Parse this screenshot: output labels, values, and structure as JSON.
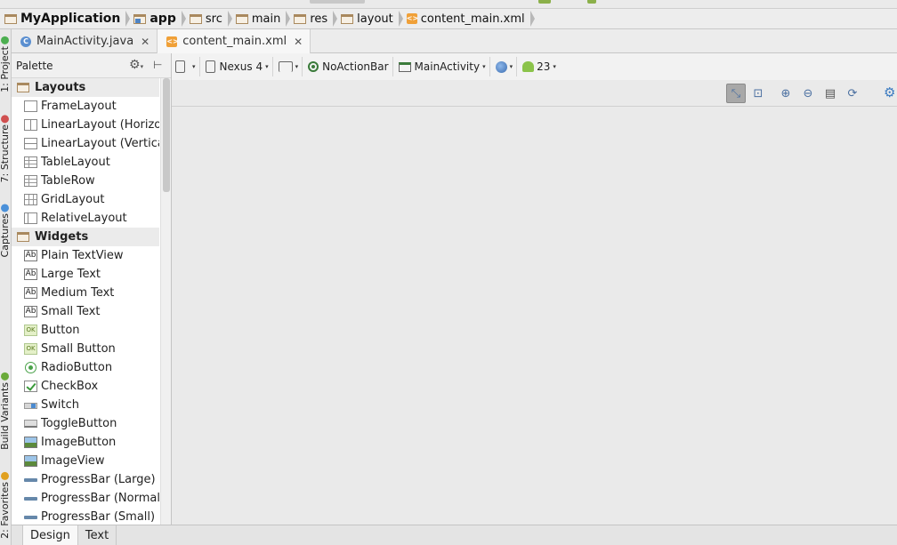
{
  "breadcrumb": [
    {
      "label": "MyApplication",
      "icon": "project-folder-icon",
      "bold": true
    },
    {
      "label": "app",
      "icon": "module-folder-icon",
      "bold": true
    },
    {
      "label": "src",
      "icon": "folder-icon",
      "bold": false
    },
    {
      "label": "main",
      "icon": "folder-icon",
      "bold": false
    },
    {
      "label": "res",
      "icon": "res-folder-icon",
      "bold": false
    },
    {
      "label": "layout",
      "icon": "folder-icon",
      "bold": false
    },
    {
      "label": "content_main.xml",
      "icon": "xml-file-icon",
      "bold": false
    }
  ],
  "side_tools": [
    {
      "label": "1: Project",
      "icon": "project-icon"
    },
    {
      "label": "7: Structure",
      "icon": "structure-icon"
    },
    {
      "label": "Captures",
      "icon": "captures-icon"
    },
    {
      "label": "Build Variants",
      "icon": "build-variants-icon"
    },
    {
      "label": "2: Favorites",
      "icon": "star-icon"
    }
  ],
  "tabs": [
    {
      "label": "MainActivity.java",
      "active": false
    },
    {
      "label": "content_main.xml",
      "active": true
    }
  ],
  "palette": {
    "title": "Palette",
    "groups": [
      {
        "name": "Layouts",
        "items": [
          {
            "label": "FrameLayout",
            "icon": "box"
          },
          {
            "label": "LinearLayout (Horizontal)",
            "icon": "hlin"
          },
          {
            "label": "LinearLayout (Vertical)",
            "icon": "vlin"
          },
          {
            "label": "TableLayout",
            "icon": "table"
          },
          {
            "label": "TableRow",
            "icon": "table"
          },
          {
            "label": "GridLayout",
            "icon": "grid"
          },
          {
            "label": "RelativeLayout",
            "icon": "rel"
          }
        ]
      },
      {
        "name": "Widgets",
        "items": [
          {
            "label": "Plain TextView",
            "icon": "ab"
          },
          {
            "label": "Large Text",
            "icon": "ab"
          },
          {
            "label": "Medium Text",
            "icon": "ab"
          },
          {
            "label": "Small Text",
            "icon": "ab"
          },
          {
            "label": "Button",
            "icon": "ok"
          },
          {
            "label": "Small Button",
            "icon": "ok"
          },
          {
            "label": "RadioButton",
            "icon": "radio"
          },
          {
            "label": "CheckBox",
            "icon": "check"
          },
          {
            "label": "Switch",
            "icon": "switch"
          },
          {
            "label": "ToggleButton",
            "icon": "toggle"
          },
          {
            "label": "ImageButton",
            "icon": "img"
          },
          {
            "label": "ImageView",
            "icon": "img"
          },
          {
            "label": "ProgressBar (Large)",
            "icon": "progress"
          },
          {
            "label": "ProgressBar (Normal)",
            "icon": "progress"
          },
          {
            "label": "ProgressBar (Small)",
            "icon": "progress"
          }
        ]
      }
    ]
  },
  "layout_toolbar": {
    "device": "Nexus 4",
    "theme": "NoActionBar",
    "activity": "MainActivity",
    "api": "23"
  },
  "bottom_tabs": [
    {
      "label": "Design",
      "active": true
    },
    {
      "label": "Text",
      "active": false
    }
  ]
}
